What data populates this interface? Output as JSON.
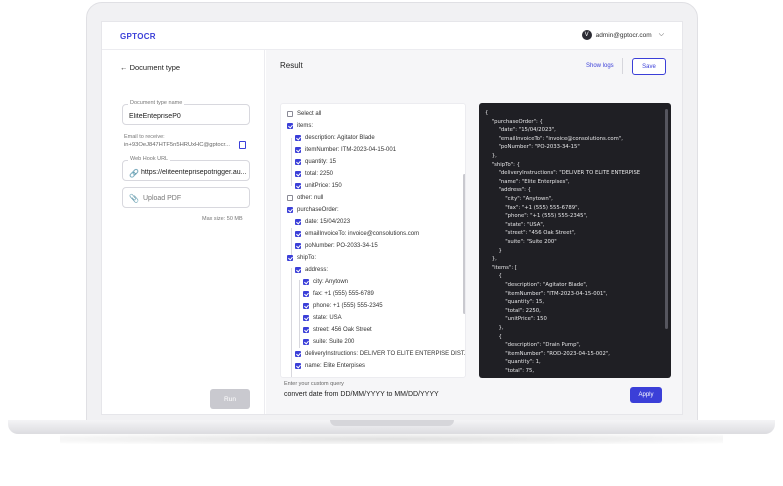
{
  "app": {
    "brand": "GPTOCR",
    "user_email": "admin@gptocr.com",
    "avatar_initial": "V"
  },
  "left": {
    "back_label": "Document type",
    "doc_type_label": "Document type name",
    "doc_type_value": "EliteEntepriseP0",
    "email_label": "Email to receive:",
    "email_value": "in+93OeJ847HTF5n5HRUxHC@gptocr...",
    "webhook_label": "Web Hook URL",
    "webhook_value": "https://eliteenteprisepotrigger.au...",
    "upload_label": "Upload PDF",
    "max_size": "Max size: 50 MB",
    "run_label": "Run"
  },
  "result": {
    "title": "Result",
    "show_logs": "Show logs",
    "save_label": "Save",
    "tree": [
      {
        "label": "Select all",
        "checked": false
      },
      {
        "label": "items:",
        "checked": true
      },
      {
        "label": "description:  Agitator Blade",
        "checked": true
      },
      {
        "label": "itemNumber:  ITM-2023-04-15-001",
        "checked": true
      },
      {
        "label": "quantity:  15",
        "checked": true
      },
      {
        "label": "total:  2250",
        "checked": true
      },
      {
        "label": "unitPrice:  150",
        "checked": true
      },
      {
        "label": "other:  null",
        "checked": false
      },
      {
        "label": "purchaseOrder:",
        "checked": true
      },
      {
        "label": "date:  15/04/2023",
        "checked": true
      },
      {
        "label": "emailInvoiceTo:  invoice@consolutions.com",
        "checked": true
      },
      {
        "label": "poNumber:  PO-2033-34-15",
        "checked": true
      },
      {
        "label": "shipTo:",
        "checked": true
      },
      {
        "label": "address:",
        "checked": true
      },
      {
        "label": "city:  Anytown",
        "checked": true
      },
      {
        "label": "fax:  +1 (555) 555-6789",
        "checked": true
      },
      {
        "label": "phone:  +1 (555) 555-2345",
        "checked": true
      },
      {
        "label": "state:  USA",
        "checked": true
      },
      {
        "label": "street:  456 Oak Street",
        "checked": true
      },
      {
        "label": "suite:  Suite 200",
        "checked": true
      },
      {
        "label": "deliveryInstructions:  DELIVER TO ELITE ENTERPISE DIST...",
        "checked": true
      },
      {
        "label": "name:  Elite Enterpises",
        "checked": true
      }
    ],
    "code_lines": [
      {
        "t": "{"
      },
      {
        "t": "    \"purchaseOrder\": {"
      },
      {
        "t": "        \"date\": \"15/04/2023\","
      },
      {
        "t": "        \"emailInvoiceTo\": \"invoice@consolutions.com\","
      },
      {
        "t": "        \"poNumber\": \"PO-2033-34-15\""
      },
      {
        "t": "    },"
      },
      {
        "t": "    \"shipTo\": {"
      },
      {
        "t": "        \"deliveryInstructions\": \"DELIVER TO ELITE ENTERPISE"
      },
      {
        "t": "        \"name\": \"Elite Enterpises\","
      },
      {
        "t": "        \"address\": {"
      },
      {
        "t": "            \"city\": \"Anytown\","
      },
      {
        "t": "            \"fax\": \"+1 (555) 555-6789\","
      },
      {
        "t": "            \"phone\": \"+1 (555) 555-2345\","
      },
      {
        "t": "            \"state\": \"USA\","
      },
      {
        "t": "            \"street\": \"456 Oak Street\","
      },
      {
        "t": "            \"suite\": \"Suite 200\""
      },
      {
        "t": "        }"
      },
      {
        "t": "    },"
      },
      {
        "t": "    \"items\": ["
      },
      {
        "t": "        {"
      },
      {
        "t": "            \"description\": \"Agitator Blade\","
      },
      {
        "t": "            \"itemNumber\": \"ITM-2023-04-15-001\","
      },
      {
        "t": "            \"quantity\": 15,"
      },
      {
        "t": "            \"total\": 2250,"
      },
      {
        "t": "            \"unitPrice\": 150"
      },
      {
        "t": "        },"
      },
      {
        "t": "        {"
      },
      {
        "t": "            \"description\": \"Drain Pump\","
      },
      {
        "t": "            \"itemNumber\": \"ROD-2023-04-15-002\","
      },
      {
        "t": "            \"quantity\": 1,"
      },
      {
        "t": "            \"total\": 75,"
      }
    ]
  },
  "query": {
    "label": "Enter your custom query",
    "value": "convert date from DD/MM/YYYY to MM/DD/YYYY",
    "apply_label": "Apply"
  }
}
